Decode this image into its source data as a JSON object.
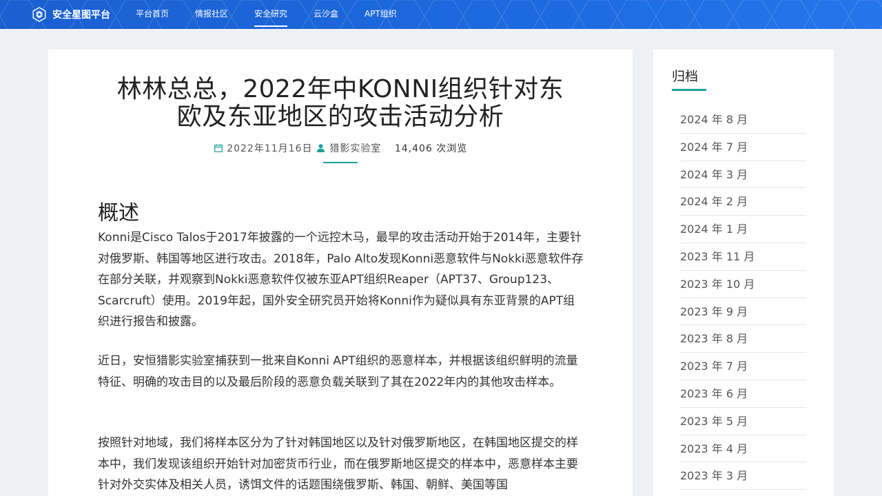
{
  "header": {
    "brand": "安全星图平台",
    "nav": [
      {
        "label": "平台首页",
        "active": false
      },
      {
        "label": "情报社区",
        "active": false
      },
      {
        "label": "安全研究",
        "active": true
      },
      {
        "label": "云沙盒",
        "active": false
      },
      {
        "label": "APT组织",
        "active": false
      }
    ]
  },
  "article": {
    "title_line1": "林林总总，2022年中KONNI组织针对东",
    "title_line2": "欧及东亚地区的攻击活动分析",
    "date": "2022年11月16日",
    "author": "猎影实验室",
    "views": "14,406 次浏览",
    "section_heading": "概述",
    "paragraphs": [
      "Konni是Cisco Talos于2017年披露的一个远控木马，最早的攻击活动开始于2014年，主要针对俄罗斯、韩国等地区进行攻击。2018年，Palo Alto发现Konni恶意软件与Nokki恶意软件存在部分关联，并观察到Nokki恶意软件仅被东亚APT组织Reaper（APT37、Group123、Scarcruft）使用。2019年起，国外安全研究员开始将Konni作为疑似具有东亚背景的APT组织进行报告和披露。",
      "近日，安恒猎影实验室捕获到一批来自Konni APT组织的恶意样本，并根据该组织鲜明的流量特征、明确的攻击目的以及最后阶段的恶意负载关联到了其在2022年内的其他攻击样本。",
      "按照针对地域，我们将样本区分为了针对韩国地区以及针对俄罗斯地区，在韩国地区提交的样本中，我们发现该组织开始针对加密货币行业，而在俄罗斯地区提交的样本中，恶意样本主要针对外交实体及相关人员，诱饵文件的话题围绕俄罗斯、韩国、朝鲜、美国等国"
    ]
  },
  "sidebar": {
    "title": "归档",
    "items": [
      "2024 年 8 月",
      "2024 年 7 月",
      "2024 年 3 月",
      "2024 年 2 月",
      "2024 年 1 月",
      "2023 年 11 月",
      "2023 年 10 月",
      "2023 年 9 月",
      "2023 年 8 月",
      "2023 年 7 月",
      "2023 年 6 月",
      "2023 年 5 月",
      "2023 年 4 月",
      "2023 年 3 月"
    ]
  },
  "colors": {
    "header_blue": "#1c66d8",
    "accent_teal": "#1aa19a",
    "background": "#eef1f4"
  },
  "icons": {
    "brand": "hexagon-logo-icon",
    "date": "calendar-icon",
    "author": "user-icon"
  }
}
